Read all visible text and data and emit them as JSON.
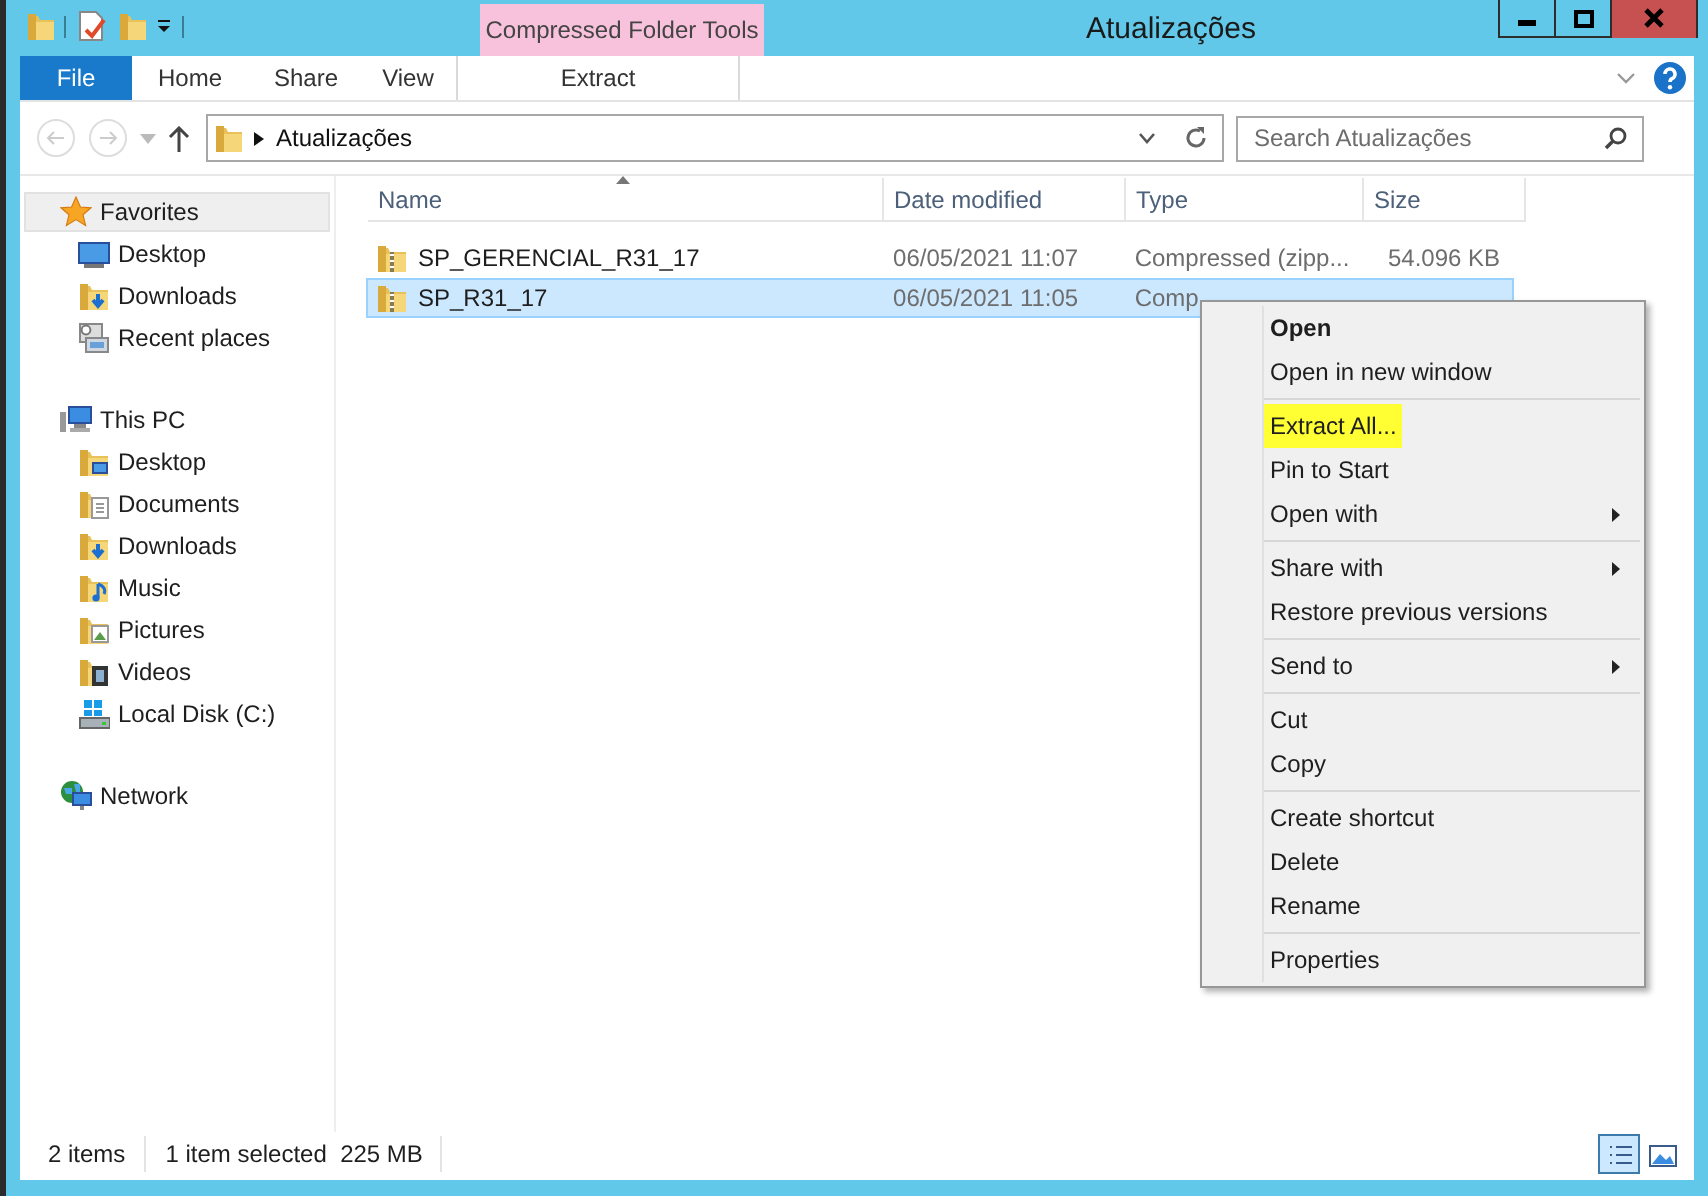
{
  "window": {
    "title": "Atualizações"
  },
  "ribbon": {
    "tabs": [
      {
        "label": "File",
        "kind": "file"
      },
      {
        "label": "Home",
        "kind": "tab"
      },
      {
        "label": "Share",
        "kind": "tab"
      },
      {
        "label": "View",
        "kind": "tab"
      }
    ],
    "contextual": {
      "label": "Compressed Folder Tools",
      "tabs": [
        {
          "label": "Extract"
        }
      ]
    }
  },
  "address": {
    "path": "Atualizações"
  },
  "search": {
    "placeholder": "Search Atualizações"
  },
  "sidebar": {
    "sections": [
      {
        "label": "Favorites",
        "selected": true,
        "children": [
          {
            "label": "Desktop"
          },
          {
            "label": "Downloads"
          },
          {
            "label": "Recent places"
          }
        ]
      },
      {
        "label": "This PC",
        "selected": false,
        "children": [
          {
            "label": "Desktop"
          },
          {
            "label": "Documents"
          },
          {
            "label": "Downloads"
          },
          {
            "label": "Music"
          },
          {
            "label": "Pictures"
          },
          {
            "label": "Videos"
          },
          {
            "label": "Local Disk (C:)"
          }
        ]
      },
      {
        "label": "Network",
        "selected": false
      }
    ]
  },
  "table": {
    "columns": [
      "Name",
      "Date modified",
      "Type",
      "Size"
    ],
    "rows": [
      {
        "name": "SP_GERENCIAL_R31_17",
        "date": "06/05/2021 11:07",
        "type": "Compressed (zipp...",
        "size": "54.096 KB",
        "selected": false
      },
      {
        "name": "SP_R31_17",
        "date": "06/05/2021 11:05",
        "type": "Comp",
        "selected": true
      }
    ]
  },
  "context_menu": {
    "groups": [
      [
        {
          "label": "Open",
          "default": true,
          "submenu": false,
          "highlighted": false
        },
        {
          "label": "Open in new window",
          "default": false,
          "submenu": false,
          "highlighted": false
        }
      ],
      [
        {
          "label": "Extract All...",
          "default": false,
          "submenu": false,
          "highlighted": true
        },
        {
          "label": "Pin to Start",
          "default": false,
          "submenu": false,
          "highlighted": false
        },
        {
          "label": "Open with",
          "default": false,
          "submenu": true,
          "highlighted": false
        }
      ],
      [
        {
          "label": "Share with",
          "default": false,
          "submenu": true,
          "highlighted": false
        },
        {
          "label": "Restore previous versions",
          "default": false,
          "submenu": false,
          "highlighted": false
        }
      ],
      [
        {
          "label": "Send to",
          "default": false,
          "submenu": true,
          "highlighted": false
        }
      ],
      [
        {
          "label": "Cut",
          "default": false,
          "submenu": false,
          "highlighted": false
        },
        {
          "label": "Copy",
          "default": false,
          "submenu": false,
          "highlighted": false
        }
      ],
      [
        {
          "label": "Create shortcut",
          "default": false,
          "submenu": false,
          "highlighted": false
        },
        {
          "label": "Delete",
          "default": false,
          "submenu": false,
          "highlighted": false
        },
        {
          "label": "Rename",
          "default": false,
          "submenu": false,
          "highlighted": false
        }
      ],
      [
        {
          "label": "Properties",
          "default": false,
          "submenu": false,
          "highlighted": false
        }
      ]
    ]
  },
  "status_bar": {
    "items": [
      "2 items",
      "1 item selected  225 MB"
    ],
    "views": [
      {
        "selected": true
      },
      {
        "selected": false
      }
    ]
  }
}
